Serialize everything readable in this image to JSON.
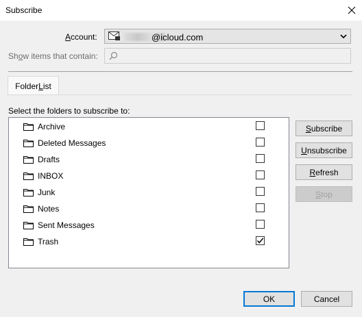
{
  "window": {
    "title": "Subscribe"
  },
  "account": {
    "label_pre": "",
    "label_key": "A",
    "label_post": "ccount:",
    "value": "@icloud.com"
  },
  "search": {
    "label_pre": "Sh",
    "label_key": "o",
    "label_post": "w items that contain:",
    "placeholder": ""
  },
  "tabs": [
    {
      "label_pre": "Folder ",
      "label_key": "L",
      "label_post": "ist"
    }
  ],
  "list": {
    "heading": "Select the folders to subscribe to:",
    "folders": [
      {
        "name": "Archive",
        "checked": false
      },
      {
        "name": "Deleted Messages",
        "checked": false
      },
      {
        "name": "Drafts",
        "checked": false
      },
      {
        "name": "INBOX",
        "checked": false
      },
      {
        "name": "Junk",
        "checked": false
      },
      {
        "name": "Notes",
        "checked": false
      },
      {
        "name": "Sent Messages",
        "checked": false
      },
      {
        "name": "Trash",
        "checked": true
      }
    ]
  },
  "actions": {
    "subscribe": {
      "key": "S",
      "rest": "ubscribe"
    },
    "unsubscribe": {
      "key": "U",
      "rest": "nsubscribe"
    },
    "refresh": {
      "key": "R",
      "rest": "efresh"
    },
    "stop": {
      "key": "S",
      "rest": "top"
    }
  },
  "dialog": {
    "ok": "OK",
    "cancel": "Cancel"
  }
}
